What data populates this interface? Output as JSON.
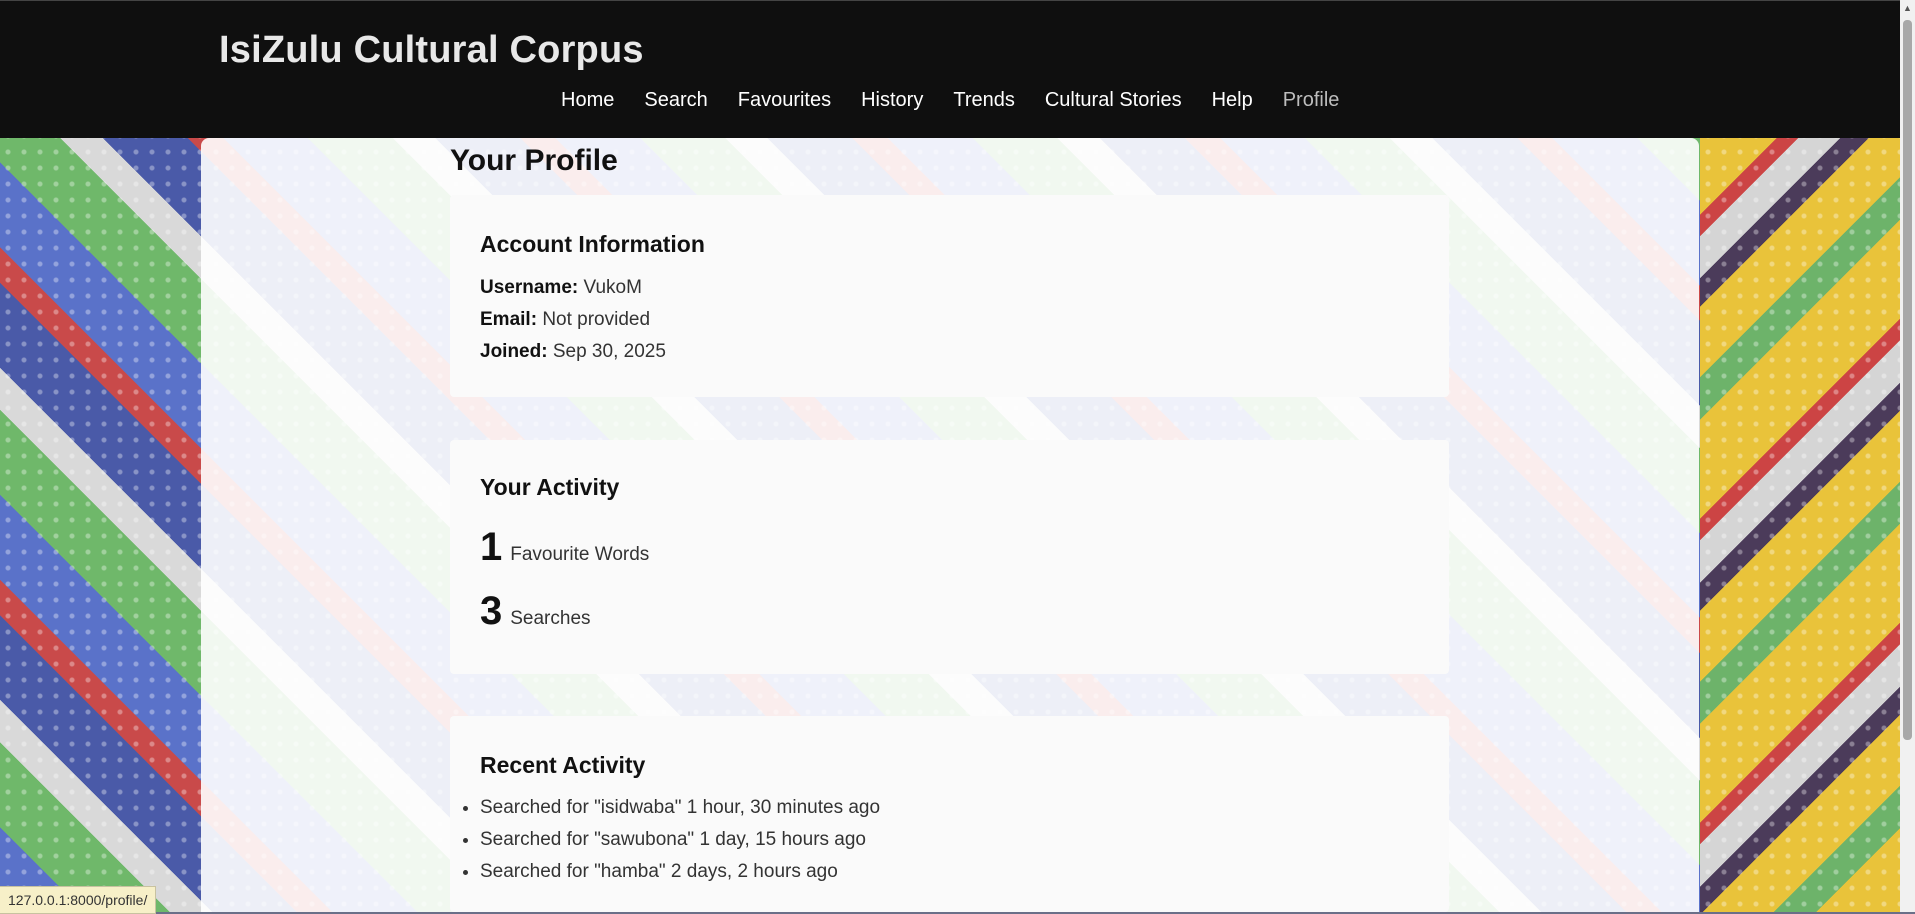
{
  "site": {
    "title": "IsiZulu Cultural Corpus"
  },
  "nav": [
    {
      "label": "Home"
    },
    {
      "label": "Search"
    },
    {
      "label": "Favourites"
    },
    {
      "label": "History"
    },
    {
      "label": "Trends"
    },
    {
      "label": "Cultural Stories"
    },
    {
      "label": "Help"
    },
    {
      "label": "Profile",
      "active": true
    }
  ],
  "page": {
    "title": "Your Profile"
  },
  "account": {
    "heading": "Account Information",
    "username_label": "Username:",
    "username": "VukoM",
    "email_label": "Email:",
    "email": "Not provided",
    "joined_label": "Joined:",
    "joined": "Sep 30, 2025"
  },
  "activity": {
    "heading": "Your Activity",
    "favourites_count": "1",
    "favourites_label": "Favourite Words",
    "searches_count": "3",
    "searches_label": "Searches"
  },
  "recent": {
    "heading": "Recent Activity",
    "items": [
      {
        "text": "Searched for \"isidwaba\" 1 hour, 30 minutes ago"
      },
      {
        "text": "Searched for \"sawubona\" 1 day, 15 hours ago"
      },
      {
        "text": "Searched for \"hamba\" 2 days, 2 hours ago"
      }
    ]
  },
  "status_bar": {
    "url": "127.0.0.1:8000/profile/"
  },
  "colors": {
    "header_bg": "#0f0f0f",
    "active_nav": "#bdbdbd"
  }
}
